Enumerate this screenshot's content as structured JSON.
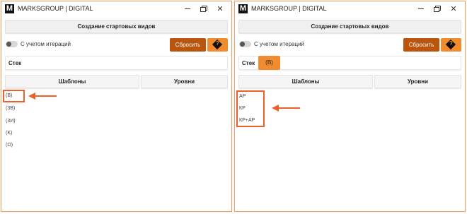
{
  "colors": {
    "window_border": "#f0a060",
    "reset_bg": "#b9550d",
    "accent": "#f08c2e",
    "annotation": "#e8622a"
  },
  "app_title": "MARKSGROUP | DIGITAL",
  "logo_letter": "M",
  "create_button": "Создание стартовых видов",
  "iterations_toggle": {
    "label": "С учетом итераций",
    "on": false
  },
  "reset_button": "Сбросить",
  "help_icon": "?",
  "stack_label": "Стек",
  "tabs": {
    "templates": "Шаблоны",
    "levels": "Уровни"
  },
  "left_window": {
    "list": [
      "(B)",
      "(3B)",
      "(3И)",
      "(K)",
      "(O)"
    ]
  },
  "right_window": {
    "stack_chip": "(B)",
    "list": [
      "АР",
      "КР",
      "КР+АР"
    ]
  },
  "icons": {
    "minimize": "minimize-icon",
    "restore": "restore-icon",
    "close": "close-icon",
    "help": "help-diamond-icon",
    "arrow": "annotation-arrow-icon"
  }
}
